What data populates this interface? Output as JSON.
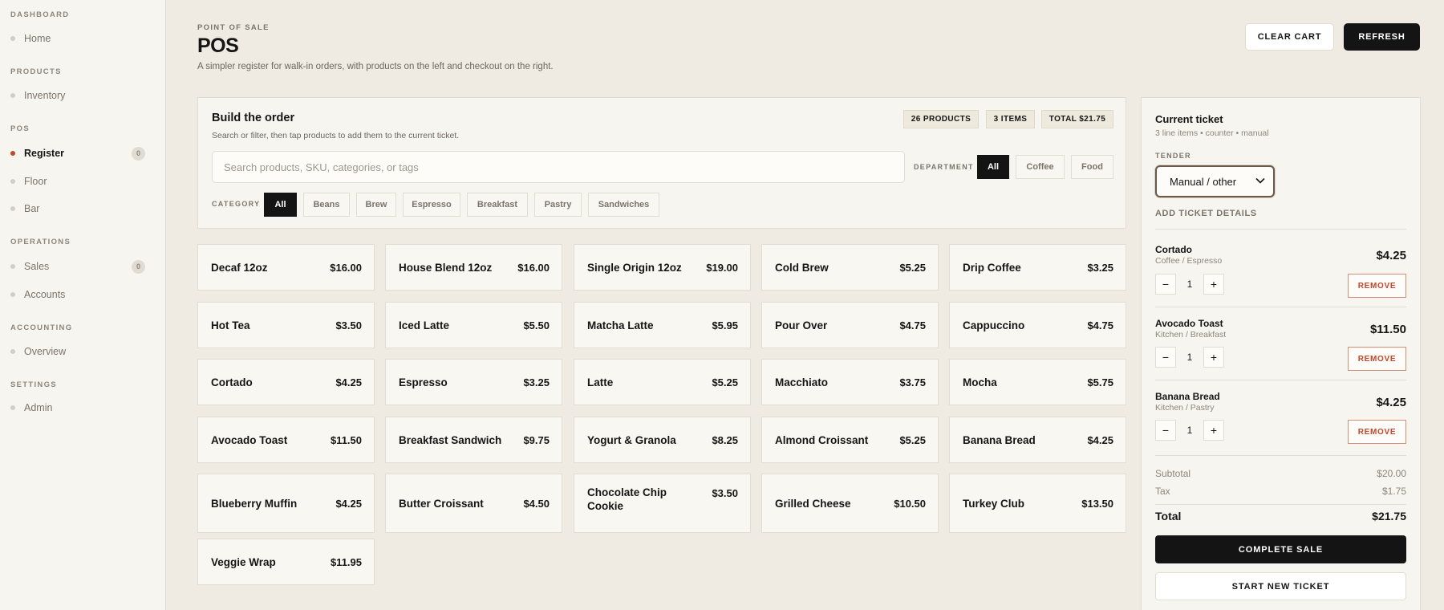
{
  "sidebar": {
    "sections": [
      {
        "label": "DASHBOARD",
        "items": [
          {
            "label": "Home"
          }
        ]
      },
      {
        "label": "PRODUCTS",
        "items": [
          {
            "label": "Inventory"
          }
        ]
      },
      {
        "label": "POS",
        "items": [
          {
            "label": "Register",
            "badge": "0",
            "active": true
          },
          {
            "label": "Floor"
          },
          {
            "label": "Bar"
          }
        ]
      },
      {
        "label": "OPERATIONS",
        "items": [
          {
            "label": "Sales",
            "badge": "0"
          },
          {
            "label": "Accounts"
          }
        ]
      },
      {
        "label": "ACCOUNTING",
        "items": [
          {
            "label": "Overview"
          }
        ]
      },
      {
        "label": "SETTINGS",
        "items": [
          {
            "label": "Admin"
          }
        ]
      }
    ]
  },
  "header": {
    "eyebrow": "POINT OF SALE",
    "title": "POS",
    "subtitle": "A simpler register for walk-in orders, with products on the left and checkout on the right.",
    "clear_cart_label": "CLEAR CART",
    "refresh_label": "REFRESH"
  },
  "build": {
    "title": "Build the order",
    "subtitle": "Search or filter, then tap products to add them to the current ticket.",
    "chips": {
      "products": "26 PRODUCTS",
      "items": "3 ITEMS",
      "total": "TOTAL $21.75"
    },
    "search_placeholder": "Search products, SKU, categories, or tags",
    "department_label": "DEPARTMENT",
    "departments": [
      {
        "label": "All",
        "active": true
      },
      {
        "label": "Coffee"
      },
      {
        "label": "Food"
      }
    ],
    "category_label": "CATEGORY",
    "categories": [
      {
        "label": "All",
        "active": true
      },
      {
        "label": "Beans"
      },
      {
        "label": "Brew"
      },
      {
        "label": "Espresso"
      },
      {
        "label": "Breakfast"
      },
      {
        "label": "Pastry"
      },
      {
        "label": "Sandwiches"
      }
    ]
  },
  "products": [
    {
      "name": "Decaf 12oz",
      "price": "$16.00"
    },
    {
      "name": "House Blend 12oz",
      "price": "$16.00"
    },
    {
      "name": "Single Origin 12oz",
      "price": "$19.00"
    },
    {
      "name": "Cold Brew",
      "price": "$5.25"
    },
    {
      "name": "Drip Coffee",
      "price": "$3.25"
    },
    {
      "name": "Hot Tea",
      "price": "$3.50"
    },
    {
      "name": "Iced Latte",
      "price": "$5.50"
    },
    {
      "name": "Matcha Latte",
      "price": "$5.95"
    },
    {
      "name": "Pour Over",
      "price": "$4.75"
    },
    {
      "name": "Cappuccino",
      "price": "$4.75"
    },
    {
      "name": "Cortado",
      "price": "$4.25"
    },
    {
      "name": "Espresso",
      "price": "$3.25"
    },
    {
      "name": "Latte",
      "price": "$5.25"
    },
    {
      "name": "Macchiato",
      "price": "$3.75"
    },
    {
      "name": "Mocha",
      "price": "$5.75"
    },
    {
      "name": "Avocado Toast",
      "price": "$11.50"
    },
    {
      "name": "Breakfast Sandwich",
      "price": "$9.75"
    },
    {
      "name": "Yogurt & Granola",
      "price": "$8.25"
    },
    {
      "name": "Almond Croissant",
      "price": "$5.25"
    },
    {
      "name": "Banana Bread",
      "price": "$4.25"
    },
    {
      "name": "Blueberry Muffin",
      "price": "$4.25"
    },
    {
      "name": "Butter Croissant",
      "price": "$4.50"
    },
    {
      "name": "Chocolate Chip Cookie",
      "price": "$3.50"
    },
    {
      "name": "Grilled Cheese",
      "price": "$10.50"
    },
    {
      "name": "Turkey Club",
      "price": "$13.50"
    },
    {
      "name": "Veggie Wrap",
      "price": "$11.95"
    }
  ],
  "ticket": {
    "title": "Current ticket",
    "subtitle": "3 line items • counter • manual",
    "tender_label": "TENDER",
    "tender_value": "Manual / other",
    "add_details_label": "ADD TICKET DETAILS",
    "lines": [
      {
        "name": "Cortado",
        "category": "Coffee / Espresso",
        "price": "$4.25",
        "qty": "1",
        "remove_label": "REMOVE"
      },
      {
        "name": "Avocado Toast",
        "category": "Kitchen / Breakfast",
        "price": "$11.50",
        "qty": "1",
        "remove_label": "REMOVE"
      },
      {
        "name": "Banana Bread",
        "category": "Kitchen / Pastry",
        "price": "$4.25",
        "qty": "1",
        "remove_label": "REMOVE"
      }
    ],
    "subtotal_label": "Subtotal",
    "subtotal": "$20.00",
    "tax_label": "Tax",
    "tax": "$1.75",
    "total_label": "Total",
    "total": "$21.75",
    "complete_label": "COMPLETE SALE",
    "new_ticket_label": "START NEW TICKET"
  },
  "colors": {
    "accent": "#c0472c",
    "dark": "#141414",
    "background": "#efebe2"
  }
}
